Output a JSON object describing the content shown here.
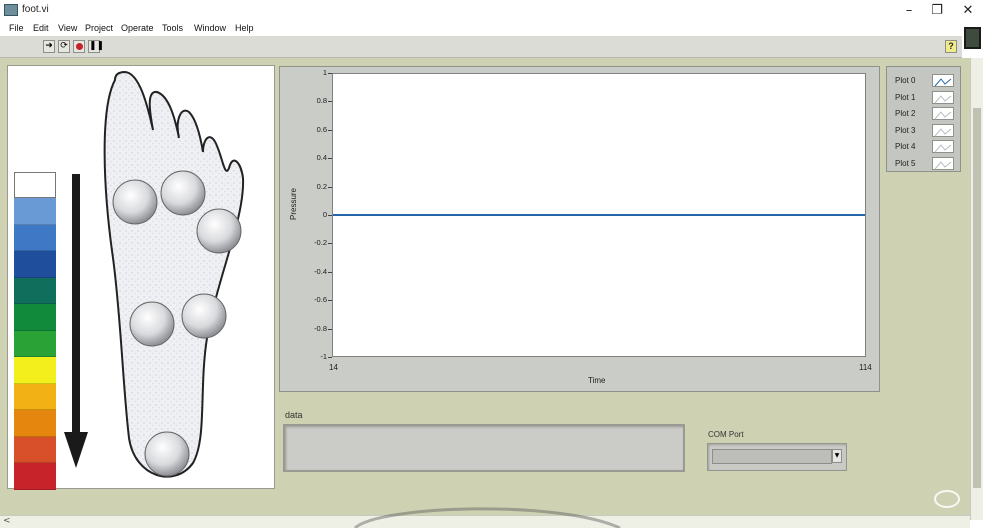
{
  "window": {
    "title": "foot.vi",
    "minimize_glyph": "–",
    "restore_glyph": "❐",
    "close_glyph": "✕"
  },
  "menu": [
    "File",
    "Edit",
    "View",
    "Project",
    "Operate",
    "Tools",
    "Window",
    "Help"
  ],
  "toolbar": {
    "icons": [
      "run-arrow-icon",
      "run-continuously-icon",
      "abort-stop-icon",
      "pause-icon"
    ],
    "help_glyph": "?"
  },
  "pressure_scale": {
    "colors": [
      "#ffffff",
      "#6a9ad6",
      "#3f78c4",
      "#1f4f9c",
      "#0f6f5c",
      "#118a3c",
      "#2aa236",
      "#f2ef1c",
      "#f2b114",
      "#e5860f",
      "#d8502a",
      "#c7232a"
    ]
  },
  "graph": {
    "y_title": "Pressure",
    "x_title": "Time",
    "y_ticks": [
      "1",
      "0.8",
      "0.6",
      "0.4",
      "0.2",
      "0",
      "-0.2",
      "-0.4",
      "-0.6",
      "-0.8",
      "-1"
    ],
    "x_ticks": [
      "14",
      "114"
    ],
    "line_color": "#2566a8"
  },
  "chart_data": {
    "type": "line",
    "title": "",
    "xlabel": "Time",
    "ylabel": "Pressure",
    "xlim": [
      14,
      114
    ],
    "ylim": [
      -1,
      1
    ],
    "series": [
      {
        "name": "Plot 0",
        "x": [
          14,
          114
        ],
        "values": [
          0,
          0
        ]
      }
    ]
  },
  "legend": [
    "Plot 0",
    "Plot 1",
    "Plot 2",
    "Plot 3",
    "Plot 4",
    "Plot 5"
  ],
  "data_label": "data",
  "data_value": "",
  "com_port": {
    "label": "COM Port",
    "value": ""
  },
  "scroll_glyph": "<"
}
